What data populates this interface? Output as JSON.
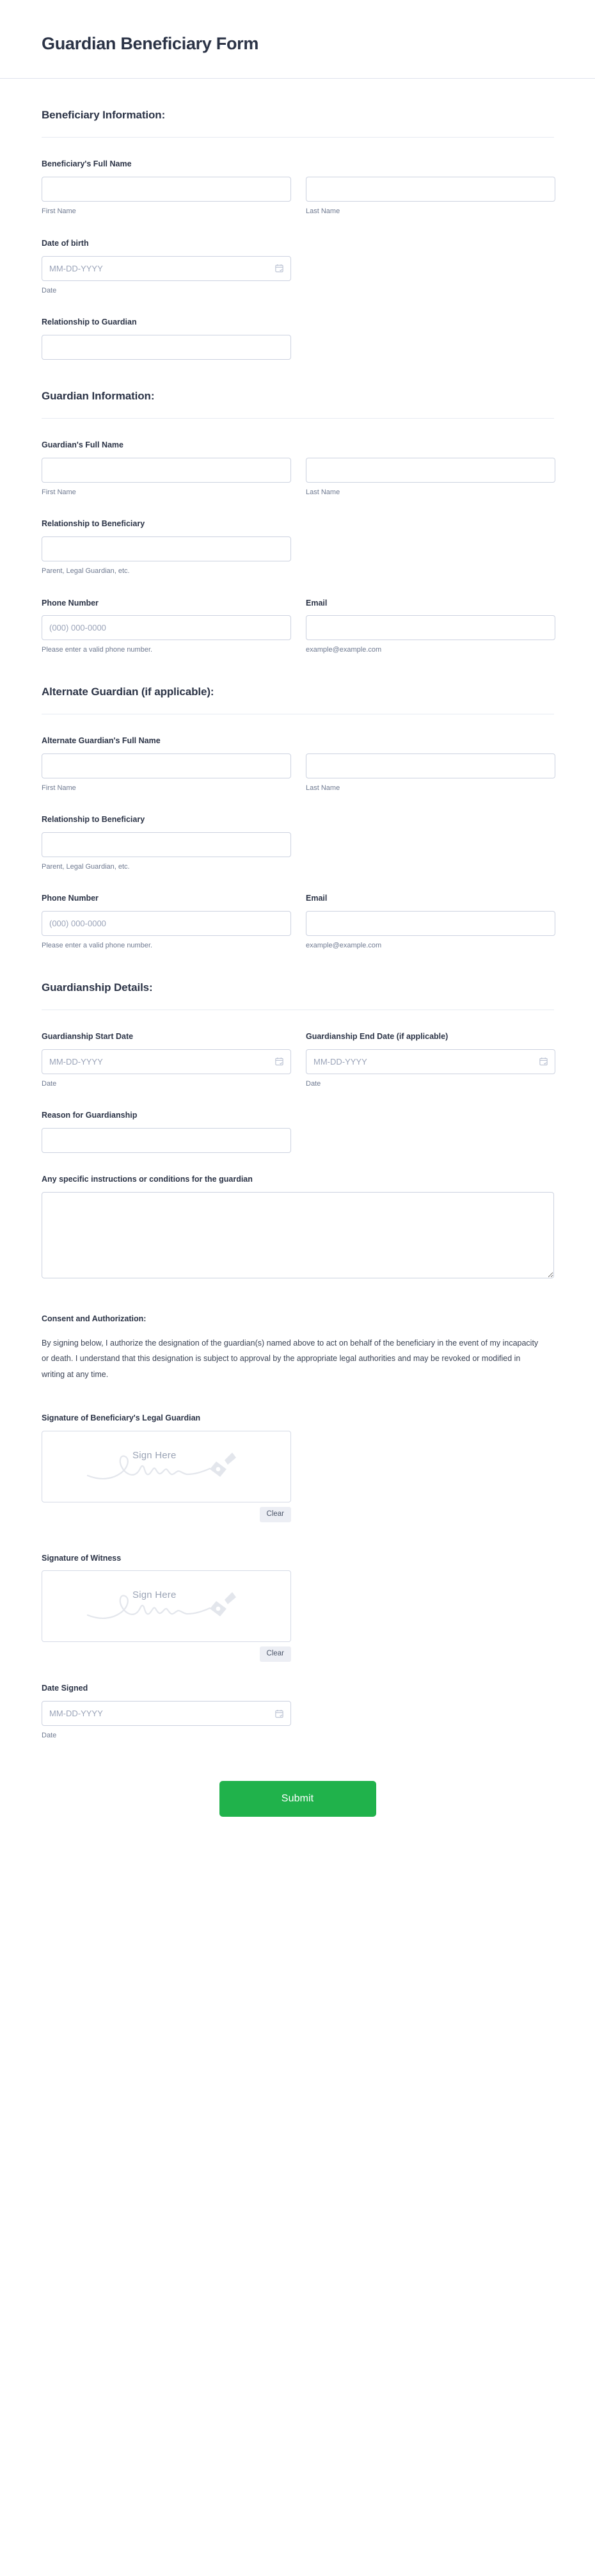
{
  "form": {
    "title": "Guardian Beneficiary Form"
  },
  "sections": {
    "beneficiary": {
      "heading": "Beneficiary Information:",
      "full_name": {
        "label": "Beneficiary's Full Name",
        "first_hint": "First Name",
        "last_hint": "Last Name"
      },
      "dob": {
        "label": "Date of birth",
        "placeholder": "MM-DD-YYYY",
        "hint": "Date"
      },
      "relationship": {
        "label": "Relationship to Guardian"
      }
    },
    "guardian": {
      "heading": "Guardian Information:",
      "full_name": {
        "label": "Guardian's Full Name",
        "first_hint": "First Name",
        "last_hint": "Last Name"
      },
      "relationship": {
        "label": "Relationship to Beneficiary",
        "hint": "Parent, Legal Guardian, etc."
      },
      "phone": {
        "label": "Phone Number",
        "placeholder": "(000) 000-0000",
        "hint": "Please enter a valid phone number."
      },
      "email": {
        "label": "Email",
        "hint": "example@example.com"
      }
    },
    "alternate": {
      "heading": "Alternate Guardian (if applicable):",
      "full_name": {
        "label": "Alternate Guardian's Full Name",
        "first_hint": "First Name",
        "last_hint": "Last Name"
      },
      "relationship": {
        "label": "Relationship to Beneficiary",
        "hint": "Parent, Legal Guardian, etc."
      },
      "phone": {
        "label": "Phone Number",
        "placeholder": "(000) 000-0000",
        "hint": "Please enter a valid phone number."
      },
      "email": {
        "label": "Email",
        "hint": "example@example.com"
      }
    },
    "details": {
      "heading": "Guardianship Details:",
      "start_date": {
        "label": "Guardianship Start Date",
        "placeholder": "MM-DD-YYYY",
        "hint": "Date"
      },
      "end_date": {
        "label": "Guardianship End Date (if applicable)",
        "placeholder": "MM-DD-YYYY",
        "hint": "Date"
      },
      "reason": {
        "label": "Reason for Guardianship"
      },
      "instructions": {
        "label": "Any specific instructions or conditions for the guardian"
      }
    },
    "consent": {
      "title": "Consent and Authorization:",
      "body": "By signing below, I authorize the designation of the guardian(s) named above to act on behalf of the beneficiary in the event of my incapacity or death. I understand that this designation is subject to approval by the appropriate legal authorities and may be revoked or modified in writing at any time."
    },
    "signatures": {
      "guardian_signature": {
        "label": "Signature of Beneficiary's Legal Guardian",
        "pad_hint": "Sign Here",
        "clear_label": "Clear"
      },
      "witness_signature": {
        "label": "Signature of Witness",
        "pad_hint": "Sign Here",
        "clear_label": "Clear"
      },
      "date_signed": {
        "label": "Date Signed",
        "placeholder": "MM-DD-YYYY",
        "hint": "Date"
      }
    }
  },
  "footer": {
    "submit_label": "Submit"
  },
  "colors": {
    "submit_green": "#20b24b",
    "heading_navy": "#2b3346",
    "hint_gray": "#6e7990",
    "border_gray": "#ccd2e0"
  }
}
